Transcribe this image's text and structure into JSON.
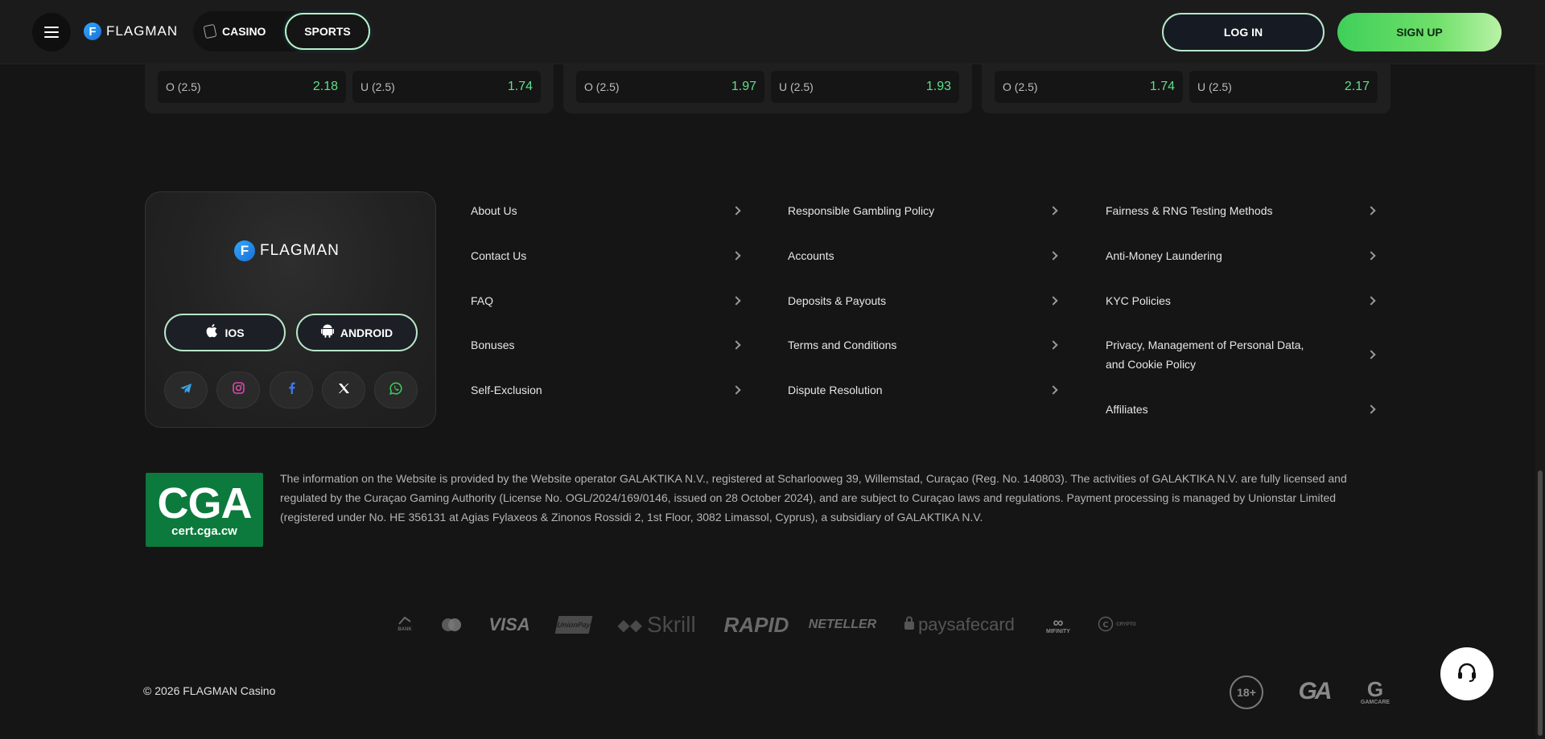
{
  "header": {
    "brand": "FLAGMAN",
    "brand_mark": "F",
    "casino_label": "CASINO",
    "sports_label": "SPORTS",
    "login_label": "LOG IN",
    "signup_label": "SIGN UP"
  },
  "odds_cards": [
    {
      "over_label": "O (2.5)",
      "over_value": "2.18",
      "under_label": "U (2.5)",
      "under_value": "1.74"
    },
    {
      "over_label": "O (2.5)",
      "over_value": "1.97",
      "under_label": "U (2.5)",
      "under_value": "1.93"
    },
    {
      "over_label": "O (2.5)",
      "over_value": "1.74",
      "under_label": "U (2.5)",
      "under_value": "2.17"
    }
  ],
  "footer": {
    "brand": "FLAGMAN",
    "brand_mark": "F",
    "ios_label": "IOS",
    "android_label": "ANDROID",
    "socials": [
      "telegram-icon",
      "instagram-icon",
      "facebook-icon",
      "x-icon",
      "whatsapp-icon"
    ],
    "col1": [
      "About Us",
      "Contact Us",
      "FAQ",
      "Bonuses",
      "Self-Exclusion"
    ],
    "col2": [
      "Responsible Gambling Policy",
      "Accounts",
      "Deposits & Payouts",
      "Terms and Conditions",
      "Dispute Resolution"
    ],
    "col3": [
      "Fairness & RNG Testing Methods",
      "Anti-Money Laundering",
      "KYC Policies",
      "Privacy, Management of Personal Data, and Cookie Policy",
      "Affiliates"
    ],
    "cga_big": "CGA",
    "cga_small": "cert.cga.cw",
    "license_text": "The information on the Website is provided by the Website operator GALAKTIKA N.V., registered at Scharlooweg 39, Willemstad, Curaçao (Reg. No. 140803). The activities of GALAKTIKA N.V. are fully licensed and regulated by the Curaçao Gaming Authority (License No. OGL/2024/169/0146, issued on 28 October 2024), and are subject to Curaçao laws and regulations. Payment processing is managed by Unionstar Limited (registered under No. HE 356131 at Agias Fylaxeos & Zinonos Rossidi 2, 1st Floor, 3082 Limassol, Cyprus), a subsidiary of GALAKTIKA N.V.",
    "payments": {
      "bank": "BANK",
      "visa": "VISA",
      "unionpay": "UnionPay",
      "skrill": "Skrill",
      "rapid": "RAPID",
      "neteller": "NETELLER",
      "paysafecard": "paysafecard",
      "mifinity": "MIFINITY",
      "crypto": "CRYPTO"
    },
    "copyright": "© 2026 FLAGMAN Casino",
    "age_badge": "18+",
    "ga_text": "GA",
    "gamcare_text": "GAMCARE"
  },
  "colors": {
    "background": "#151515",
    "accent_green": "#5ee08a",
    "signup_gradient_start": "#3fcf5a",
    "cga_green": "#0c7a3c"
  }
}
